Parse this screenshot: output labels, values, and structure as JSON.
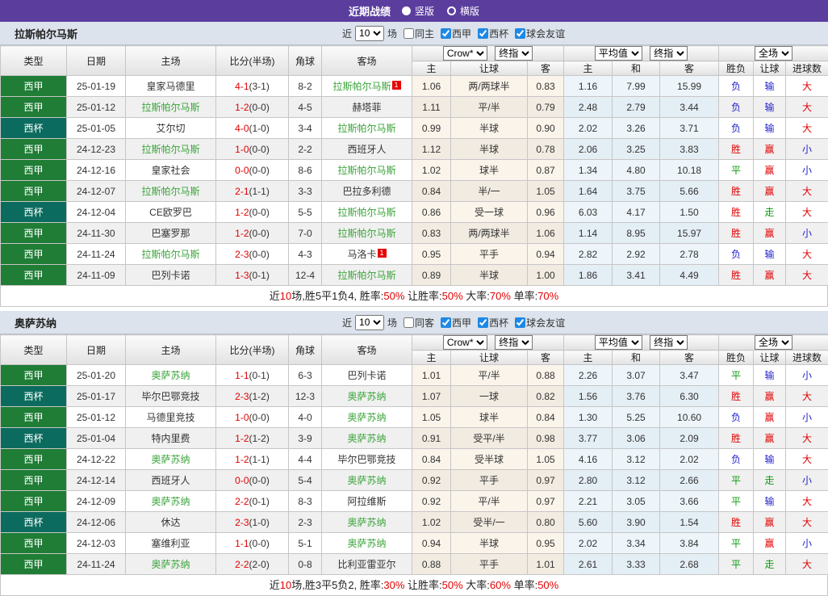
{
  "colors": {
    "topbar_purple": "#5b3d9e",
    "liga_green": "#1f7d36",
    "cup_teal": "#0b6b5e",
    "focus_team_green": "#3aa43a",
    "result_red": "#e10000",
    "result_blue": "#2222cc",
    "result_green": "#0f9b0f",
    "checkbox_blue": "#1e88e5"
  },
  "topbar": {
    "title": "近期战绩",
    "options": [
      {
        "label": "竖版",
        "selected": true
      },
      {
        "label": "横版",
        "selected": false
      }
    ]
  },
  "sections": [
    {
      "team": "拉斯帕尔马斯",
      "filter": {
        "near_label": "近",
        "count": "10",
        "games_label": "场",
        "same_label": "同主",
        "same_checked": false,
        "leagues": [
          {
            "label": "西甲",
            "checked": true
          },
          {
            "label": "西杯",
            "checked": true
          },
          {
            "label": "球会友谊",
            "checked": true
          }
        ]
      },
      "head": {
        "cols": [
          "类型",
          "日期",
          "主场",
          "比分(半场)",
          "角球",
          "客场"
        ],
        "dropdowns": [
          "Crow*",
          "终指",
          "平均值",
          "终指",
          "全场"
        ],
        "sub": [
          "主",
          "让球",
          "客",
          "主",
          "和",
          "客",
          "胜负",
          "让球",
          "进球数"
        ]
      },
      "rows": [
        {
          "type": "西甲",
          "cup": false,
          "date": "25-01-19",
          "home": {
            "name": "皇家马德里",
            "focus": false
          },
          "score": "4-1",
          "half": "3-1",
          "corner": "8-2",
          "away": {
            "name": "拉斯帕尔马斯",
            "focus": true,
            "badge": "1"
          },
          "let": [
            "1.06",
            "两/两球半",
            "0.83"
          ],
          "avg": [
            "1.16",
            "7.99",
            "15.99"
          ],
          "results": [
            {
              "t": "负",
              "c": "blue"
            },
            {
              "t": "输",
              "c": "blue"
            },
            {
              "t": "大",
              "c": "red"
            }
          ]
        },
        {
          "type": "西甲",
          "cup": false,
          "date": "25-01-12",
          "home": {
            "name": "拉斯帕尔马斯",
            "focus": true
          },
          "score": "1-2",
          "half": "0-0",
          "corner": "4-5",
          "away": {
            "name": "赫塔菲",
            "focus": false
          },
          "let": [
            "1.11",
            "平/半",
            "0.79"
          ],
          "avg": [
            "2.48",
            "2.79",
            "3.44"
          ],
          "results": [
            {
              "t": "负",
              "c": "blue"
            },
            {
              "t": "输",
              "c": "blue"
            },
            {
              "t": "大",
              "c": "red"
            }
          ]
        },
        {
          "type": "西杯",
          "cup": true,
          "date": "25-01-05",
          "home": {
            "name": "艾尔切",
            "focus": false
          },
          "score": "4-0",
          "half": "1-0",
          "corner": "3-4",
          "away": {
            "name": "拉斯帕尔马斯",
            "focus": true
          },
          "let": [
            "0.99",
            "半球",
            "0.90"
          ],
          "avg": [
            "2.02",
            "3.26",
            "3.71"
          ],
          "results": [
            {
              "t": "负",
              "c": "blue"
            },
            {
              "t": "输",
              "c": "blue"
            },
            {
              "t": "大",
              "c": "red"
            }
          ]
        },
        {
          "type": "西甲",
          "cup": false,
          "date": "24-12-23",
          "home": {
            "name": "拉斯帕尔马斯",
            "focus": true
          },
          "score": "1-0",
          "half": "0-0",
          "corner": "2-2",
          "away": {
            "name": "西班牙人",
            "focus": false
          },
          "let": [
            "1.12",
            "半球",
            "0.78"
          ],
          "avg": [
            "2.06",
            "3.25",
            "3.83"
          ],
          "results": [
            {
              "t": "胜",
              "c": "red"
            },
            {
              "t": "赢",
              "c": "red"
            },
            {
              "t": "小",
              "c": "blue"
            }
          ]
        },
        {
          "type": "西甲",
          "cup": false,
          "date": "24-12-16",
          "home": {
            "name": "皇家社会",
            "focus": false
          },
          "score": "0-0",
          "half": "0-0",
          "corner": "8-6",
          "away": {
            "name": "拉斯帕尔马斯",
            "focus": true
          },
          "let": [
            "1.02",
            "球半",
            "0.87"
          ],
          "avg": [
            "1.34",
            "4.80",
            "10.18"
          ],
          "results": [
            {
              "t": "平",
              "c": "green"
            },
            {
              "t": "赢",
              "c": "red"
            },
            {
              "t": "小",
              "c": "blue"
            }
          ]
        },
        {
          "type": "西甲",
          "cup": false,
          "date": "24-12-07",
          "home": {
            "name": "拉斯帕尔马斯",
            "focus": true
          },
          "score": "2-1",
          "half": "1-1",
          "corner": "3-3",
          "away": {
            "name": "巴拉多利德",
            "focus": false
          },
          "let": [
            "0.84",
            "半/一",
            "1.05"
          ],
          "avg": [
            "1.64",
            "3.75",
            "5.66"
          ],
          "results": [
            {
              "t": "胜",
              "c": "red"
            },
            {
              "t": "赢",
              "c": "red"
            },
            {
              "t": "大",
              "c": "red"
            }
          ]
        },
        {
          "type": "西杯",
          "cup": true,
          "date": "24-12-04",
          "home": {
            "name": "CE欧罗巴",
            "focus": false
          },
          "score": "1-2",
          "half": "0-0",
          "corner": "5-5",
          "away": {
            "name": "拉斯帕尔马斯",
            "focus": true
          },
          "let": [
            "0.86",
            "受一球",
            "0.96"
          ],
          "avg": [
            "6.03",
            "4.17",
            "1.50"
          ],
          "results": [
            {
              "t": "胜",
              "c": "red"
            },
            {
              "t": "走",
              "c": "green"
            },
            {
              "t": "大",
              "c": "red"
            }
          ]
        },
        {
          "type": "西甲",
          "cup": false,
          "date": "24-11-30",
          "home": {
            "name": "巴塞罗那",
            "focus": false
          },
          "score": "1-2",
          "half": "0-0",
          "corner": "7-0",
          "away": {
            "name": "拉斯帕尔马斯",
            "focus": true
          },
          "let": [
            "0.83",
            "两/两球半",
            "1.06"
          ],
          "avg": [
            "1.14",
            "8.95",
            "15.97"
          ],
          "results": [
            {
              "t": "胜",
              "c": "red"
            },
            {
              "t": "赢",
              "c": "red"
            },
            {
              "t": "小",
              "c": "blue"
            }
          ]
        },
        {
          "type": "西甲",
          "cup": false,
          "date": "24-11-24",
          "home": {
            "name": "拉斯帕尔马斯",
            "focus": true
          },
          "score": "2-3",
          "half": "0-0",
          "corner": "4-3",
          "away": {
            "name": "马洛卡",
            "focus": false,
            "badge": "1"
          },
          "let": [
            "0.95",
            "平手",
            "0.94"
          ],
          "avg": [
            "2.82",
            "2.92",
            "2.78"
          ],
          "results": [
            {
              "t": "负",
              "c": "blue"
            },
            {
              "t": "输",
              "c": "blue"
            },
            {
              "t": "大",
              "c": "red"
            }
          ]
        },
        {
          "type": "西甲",
          "cup": false,
          "date": "24-11-09",
          "home": {
            "name": "巴列卡诺",
            "focus": false
          },
          "score": "1-3",
          "half": "0-1",
          "corner": "12-4",
          "away": {
            "name": "拉斯帕尔马斯",
            "focus": true
          },
          "let": [
            "0.89",
            "半球",
            "1.00"
          ],
          "avg": [
            "1.86",
            "3.41",
            "4.49"
          ],
          "results": [
            {
              "t": "胜",
              "c": "red"
            },
            {
              "t": "赢",
              "c": "red"
            },
            {
              "t": "大",
              "c": "red"
            }
          ]
        }
      ],
      "summary": {
        "parts": [
          {
            "t": "近"
          },
          {
            "t": "10",
            "red": true
          },
          {
            "t": "场,胜5平1负4, 胜率:"
          },
          {
            "t": "50%",
            "red": true
          },
          {
            "t": " 让胜率:"
          },
          {
            "t": "50%",
            "red": true
          },
          {
            "t": " 大率:"
          },
          {
            "t": "70%",
            "red": true
          },
          {
            "t": " 单率:"
          },
          {
            "t": "70%",
            "red": true
          }
        ]
      }
    },
    {
      "team": "奥萨苏纳",
      "filter": {
        "near_label": "近",
        "count": "10",
        "games_label": "场",
        "same_label": "同客",
        "same_checked": false,
        "leagues": [
          {
            "label": "西甲",
            "checked": true
          },
          {
            "label": "西杯",
            "checked": true
          },
          {
            "label": "球会友谊",
            "checked": true
          }
        ]
      },
      "head": {
        "cols": [
          "类型",
          "日期",
          "主场",
          "比分(半场)",
          "角球",
          "客场"
        ],
        "dropdowns": [
          "Crow*",
          "终指",
          "平均值",
          "终指",
          "全场"
        ],
        "sub": [
          "主",
          "让球",
          "客",
          "主",
          "和",
          "客",
          "胜负",
          "让球",
          "进球数"
        ]
      },
      "rows": [
        {
          "type": "西甲",
          "cup": false,
          "date": "25-01-20",
          "home": {
            "name": "奥萨苏纳",
            "focus": true
          },
          "score": "1-1",
          "half": "0-1",
          "corner": "6-3",
          "away": {
            "name": "巴列卡诺",
            "focus": false
          },
          "let": [
            "1.01",
            "平/半",
            "0.88"
          ],
          "avg": [
            "2.26",
            "3.07",
            "3.47"
          ],
          "results": [
            {
              "t": "平",
              "c": "green"
            },
            {
              "t": "输",
              "c": "blue"
            },
            {
              "t": "小",
              "c": "blue"
            }
          ]
        },
        {
          "type": "西杯",
          "cup": true,
          "date": "25-01-17",
          "home": {
            "name": "毕尔巴鄂竞技",
            "focus": false
          },
          "score": "2-3",
          "half": "1-2",
          "corner": "12-3",
          "away": {
            "name": "奥萨苏纳",
            "focus": true
          },
          "let": [
            "1.07",
            "一球",
            "0.82"
          ],
          "avg": [
            "1.56",
            "3.76",
            "6.30"
          ],
          "results": [
            {
              "t": "胜",
              "c": "red"
            },
            {
              "t": "赢",
              "c": "red"
            },
            {
              "t": "大",
              "c": "red"
            }
          ]
        },
        {
          "type": "西甲",
          "cup": false,
          "date": "25-01-12",
          "home": {
            "name": "马德里竞技",
            "focus": false
          },
          "score": "1-0",
          "half": "0-0",
          "corner": "4-0",
          "away": {
            "name": "奥萨苏纳",
            "focus": true
          },
          "let": [
            "1.05",
            "球半",
            "0.84"
          ],
          "avg": [
            "1.30",
            "5.25",
            "10.60"
          ],
          "results": [
            {
              "t": "负",
              "c": "blue"
            },
            {
              "t": "赢",
              "c": "red"
            },
            {
              "t": "小",
              "c": "blue"
            }
          ]
        },
        {
          "type": "西杯",
          "cup": true,
          "date": "25-01-04",
          "home": {
            "name": "特内里费",
            "focus": false
          },
          "score": "1-2",
          "half": "1-2",
          "corner": "3-9",
          "away": {
            "name": "奥萨苏纳",
            "focus": true
          },
          "let": [
            "0.91",
            "受平/半",
            "0.98"
          ],
          "avg": [
            "3.77",
            "3.06",
            "2.09"
          ],
          "results": [
            {
              "t": "胜",
              "c": "red"
            },
            {
              "t": "赢",
              "c": "red"
            },
            {
              "t": "大",
              "c": "red"
            }
          ]
        },
        {
          "type": "西甲",
          "cup": false,
          "date": "24-12-22",
          "home": {
            "name": "奥萨苏纳",
            "focus": true
          },
          "score": "1-2",
          "half": "1-1",
          "corner": "4-4",
          "away": {
            "name": "毕尔巴鄂竞技",
            "focus": false
          },
          "let": [
            "0.84",
            "受半球",
            "1.05"
          ],
          "avg": [
            "4.16",
            "3.12",
            "2.02"
          ],
          "results": [
            {
              "t": "负",
              "c": "blue"
            },
            {
              "t": "输",
              "c": "blue"
            },
            {
              "t": "大",
              "c": "red"
            }
          ]
        },
        {
          "type": "西甲",
          "cup": false,
          "date": "24-12-14",
          "home": {
            "name": "西班牙人",
            "focus": false
          },
          "score": "0-0",
          "half": "0-0",
          "corner": "5-4",
          "away": {
            "name": "奥萨苏纳",
            "focus": true
          },
          "let": [
            "0.92",
            "平手",
            "0.97"
          ],
          "avg": [
            "2.80",
            "3.12",
            "2.66"
          ],
          "results": [
            {
              "t": "平",
              "c": "green"
            },
            {
              "t": "走",
              "c": "green"
            },
            {
              "t": "小",
              "c": "blue"
            }
          ]
        },
        {
          "type": "西甲",
          "cup": false,
          "date": "24-12-09",
          "home": {
            "name": "奥萨苏纳",
            "focus": true
          },
          "score": "2-2",
          "half": "0-1",
          "corner": "8-3",
          "away": {
            "name": "阿拉维斯",
            "focus": false
          },
          "let": [
            "0.92",
            "平/半",
            "0.97"
          ],
          "avg": [
            "2.21",
            "3.05",
            "3.66"
          ],
          "results": [
            {
              "t": "平",
              "c": "green"
            },
            {
              "t": "输",
              "c": "blue"
            },
            {
              "t": "大",
              "c": "red"
            }
          ]
        },
        {
          "type": "西杯",
          "cup": true,
          "date": "24-12-06",
          "home": {
            "name": "休达",
            "focus": false
          },
          "score": "2-3",
          "half": "1-0",
          "corner": "2-3",
          "away": {
            "name": "奥萨苏纳",
            "focus": true
          },
          "let": [
            "1.02",
            "受半/一",
            "0.80"
          ],
          "avg": [
            "5.60",
            "3.90",
            "1.54"
          ],
          "results": [
            {
              "t": "胜",
              "c": "red"
            },
            {
              "t": "赢",
              "c": "red"
            },
            {
              "t": "大",
              "c": "red"
            }
          ]
        },
        {
          "type": "西甲",
          "cup": false,
          "date": "24-12-03",
          "home": {
            "name": "塞维利亚",
            "focus": false
          },
          "score": "1-1",
          "half": "0-0",
          "corner": "5-1",
          "away": {
            "name": "奥萨苏纳",
            "focus": true
          },
          "let": [
            "0.94",
            "半球",
            "0.95"
          ],
          "avg": [
            "2.02",
            "3.34",
            "3.84"
          ],
          "results": [
            {
              "t": "平",
              "c": "green"
            },
            {
              "t": "赢",
              "c": "red"
            },
            {
              "t": "小",
              "c": "blue"
            }
          ]
        },
        {
          "type": "西甲",
          "cup": false,
          "date": "24-11-24",
          "home": {
            "name": "奥萨苏纳",
            "focus": true
          },
          "score": "2-2",
          "half": "2-0",
          "corner": "0-8",
          "away": {
            "name": "比利亚雷亚尔",
            "focus": false
          },
          "let": [
            "0.88",
            "平手",
            "1.01"
          ],
          "avg": [
            "2.61",
            "3.33",
            "2.68"
          ],
          "results": [
            {
              "t": "平",
              "c": "green"
            },
            {
              "t": "走",
              "c": "green"
            },
            {
              "t": "大",
              "c": "red"
            }
          ]
        }
      ],
      "summary": {
        "parts": [
          {
            "t": "近"
          },
          {
            "t": "10",
            "red": true
          },
          {
            "t": "场,胜3平5负2, 胜率:"
          },
          {
            "t": "30%",
            "red": true
          },
          {
            "t": " 让胜率:"
          },
          {
            "t": "50%",
            "red": true
          },
          {
            "t": " 大率:"
          },
          {
            "t": "60%",
            "red": true
          },
          {
            "t": " 单率:"
          },
          {
            "t": "50%",
            "red": true
          }
        ]
      }
    }
  ]
}
